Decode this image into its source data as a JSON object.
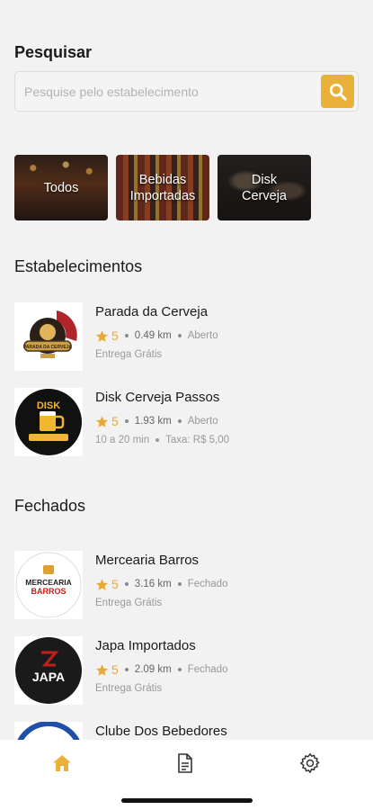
{
  "search": {
    "title": "Pesquisar",
    "placeholder": "Pesquise pelo estabelecimento"
  },
  "categories": [
    {
      "label": "Todos"
    },
    {
      "label": "Bebidas Importadas"
    },
    {
      "label": "Disk Cerveja"
    }
  ],
  "sections": {
    "open_title": "Estabelecimentos",
    "closed_title": "Fechados"
  },
  "open_stores": [
    {
      "name": "Parada da Cerveja",
      "rating": "5",
      "distance": "0.49 km",
      "status": "Aberto",
      "delivery": "Entrega Grátis"
    },
    {
      "name": "Disk Cerveja Passos",
      "rating": "5",
      "distance": "1.93 km",
      "status": "Aberto",
      "time": "10 a 20 min",
      "fee": "Taxa: R$ 5,00"
    }
  ],
  "closed_stores": [
    {
      "name": "Mercearia Barros",
      "rating": "5",
      "distance": "3.16 km",
      "status": "Fechado",
      "delivery": "Entrega Grátis"
    },
    {
      "name": "Japa Importados",
      "rating": "5",
      "distance": "2.09 km",
      "status": "Fechado",
      "delivery": "Entrega Grátis"
    },
    {
      "name": "Clube Dos Bebedores"
    }
  ],
  "logos": {
    "parada_text": "PARADA DA CERVEJA",
    "disk_text": "DISK",
    "mercearia_line1": "MERCEARIA",
    "mercearia_line2": "BARROS",
    "japa_text": "JAPA"
  },
  "colors": {
    "accent": "#eab13a",
    "background": "#f2f2f2",
    "star": "#e8a93a"
  },
  "nav": {
    "items": [
      {
        "icon": "home-icon",
        "active": true
      },
      {
        "icon": "document-icon",
        "active": false
      },
      {
        "icon": "gear-icon",
        "active": false
      }
    ]
  }
}
